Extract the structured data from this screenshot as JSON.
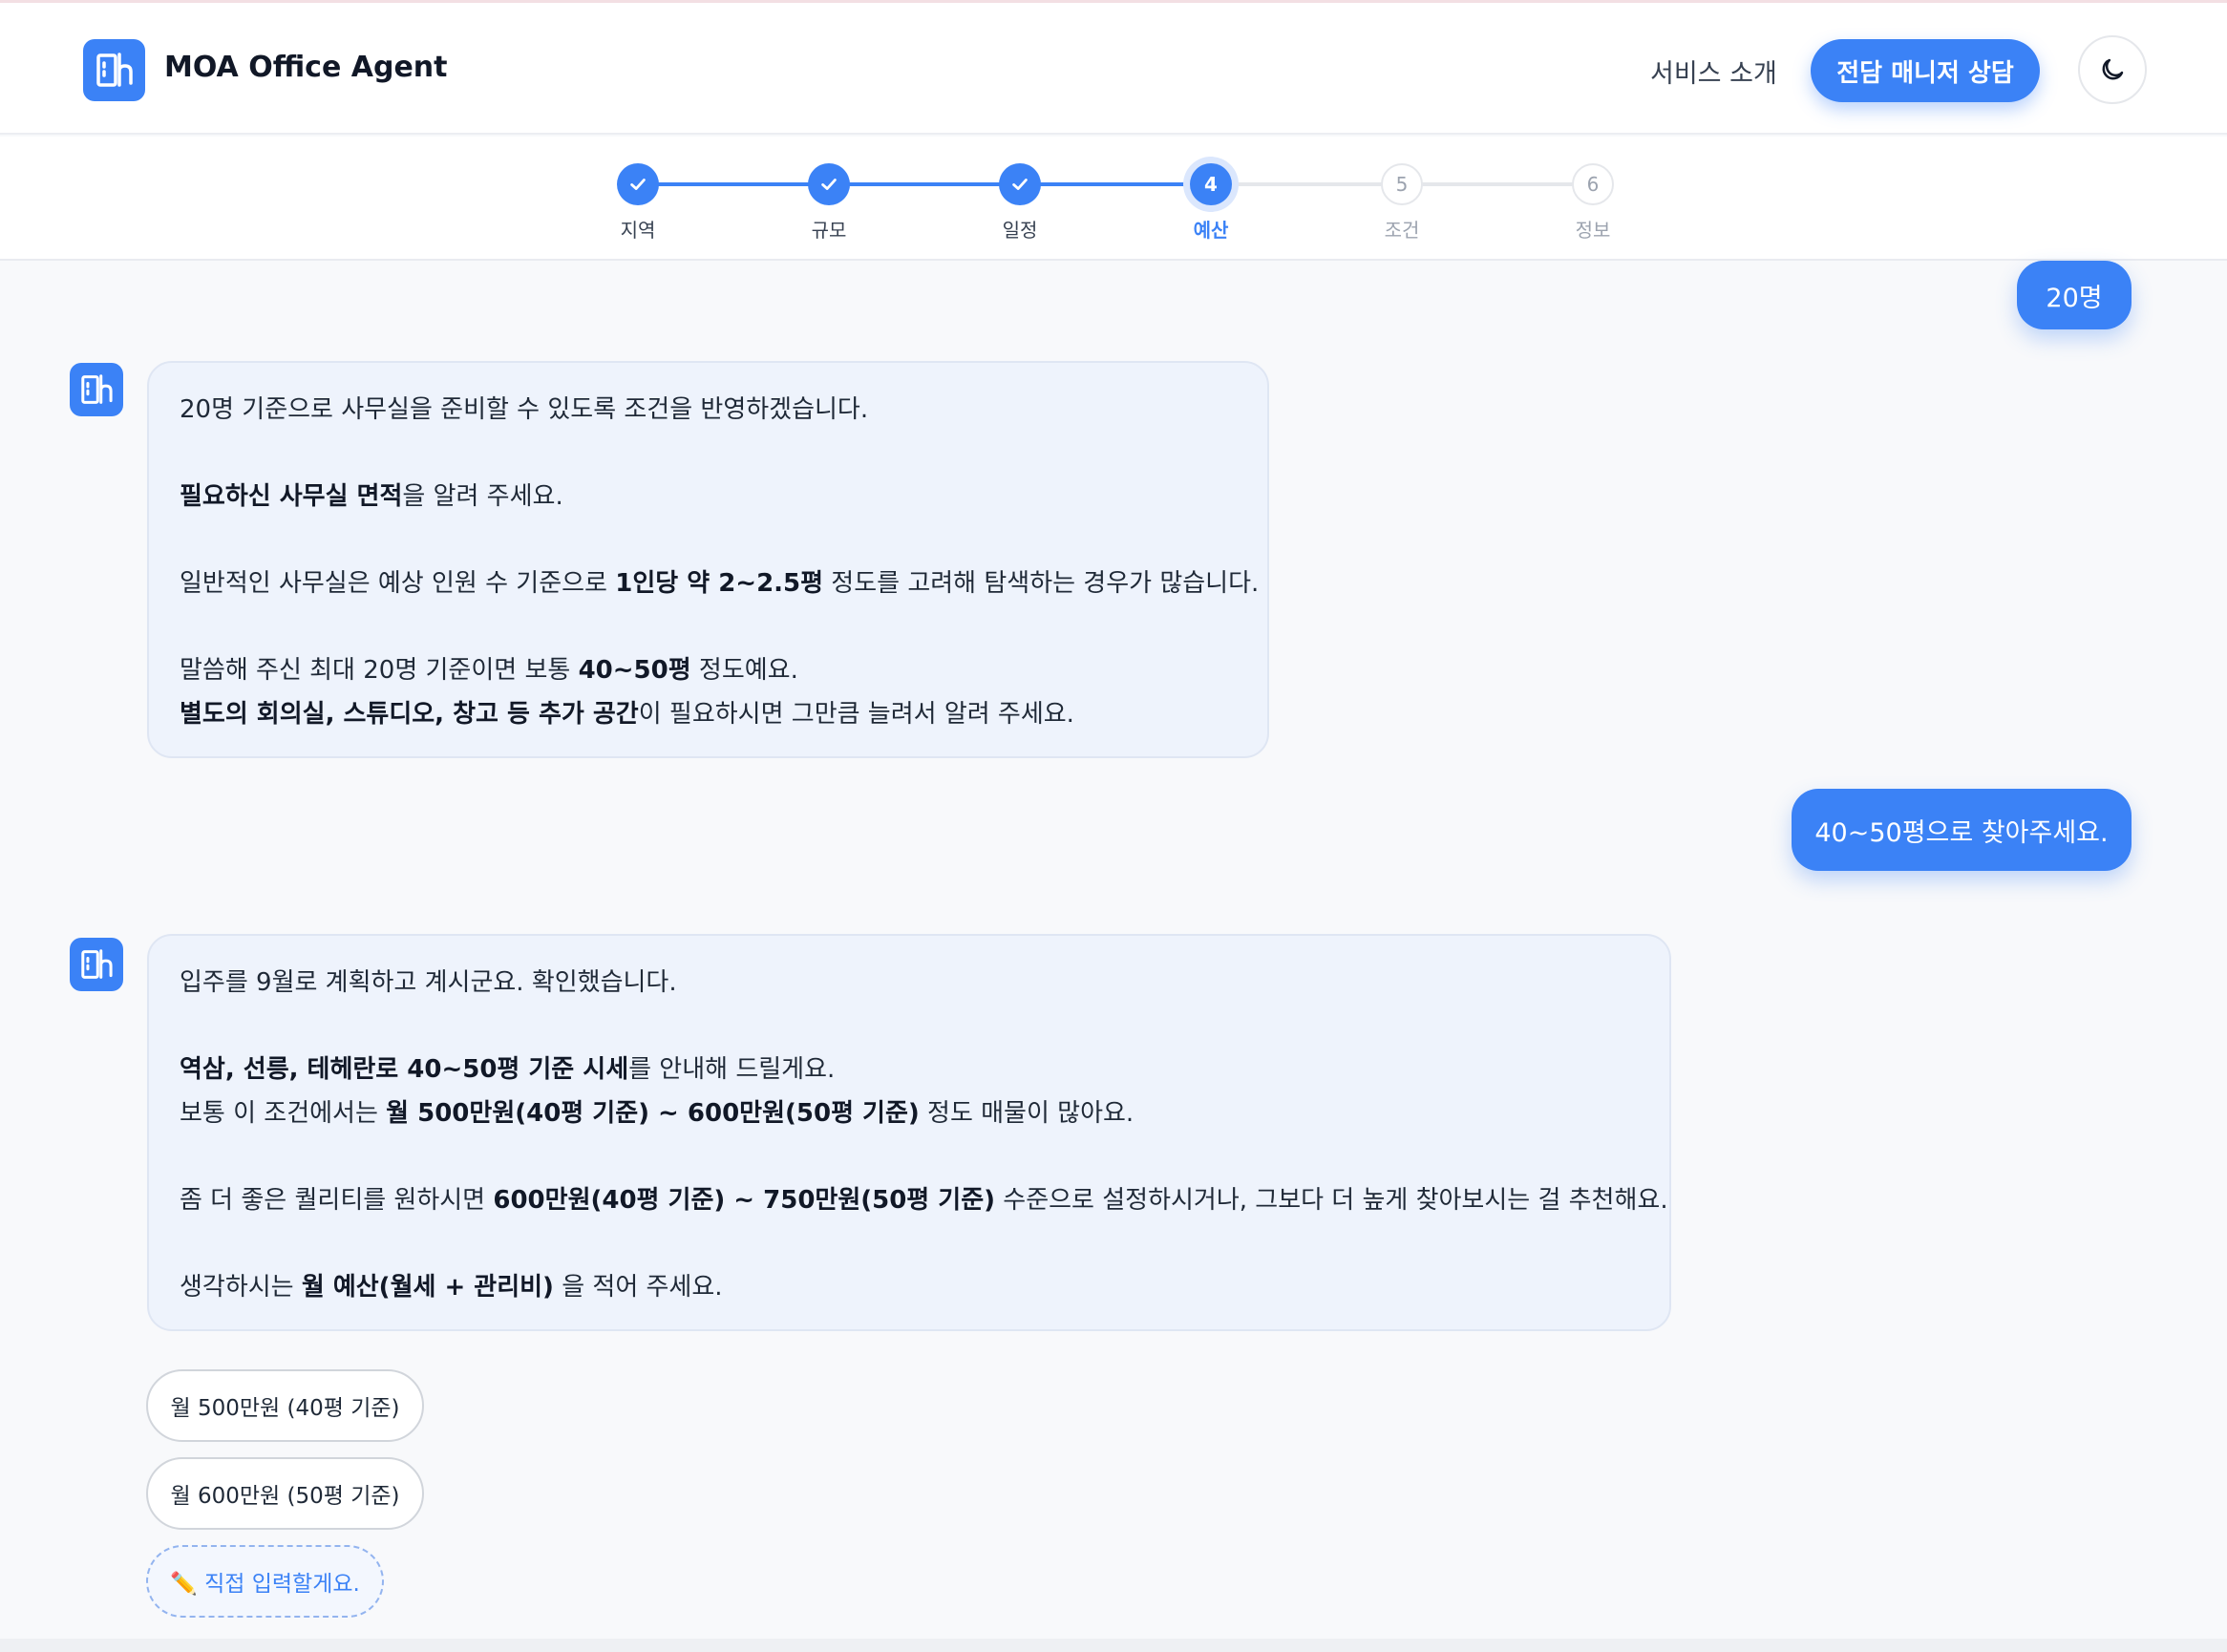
{
  "header": {
    "brand": "MOA Office Agent",
    "nav_link": "서비스 소개",
    "cta_label": "전담 매니저 상담",
    "theme_icon": "moon-icon",
    "logo_icon": "building-icon",
    "accent_color": "#3b82f6"
  },
  "steps": [
    {
      "label": "지역",
      "number": "1",
      "status": "done"
    },
    {
      "label": "규모",
      "number": "2",
      "status": "done"
    },
    {
      "label": "일정",
      "number": "3",
      "status": "done"
    },
    {
      "label": "예산",
      "number": "4",
      "status": "active"
    },
    {
      "label": "조건",
      "number": "5",
      "status": "todo"
    },
    {
      "label": "정보",
      "number": "6",
      "status": "todo"
    }
  ],
  "messages": {
    "user_1": "20명",
    "bot_1": {
      "line1": "20명 기준으로 사무실을 준비할 수 있도록 조건을 반영하겠습니다.",
      "l2_bold": "필요하신 사무실 면적",
      "l2_rest": "을 알려 주세요.",
      "l3_a": "일반적인 사무실은 예상 인원 수 기준으로 ",
      "l3_bold": "1인당 약 2~2.5평",
      "l3_b": " 정도를 고려해 탐색하는 경우가 많습니다.",
      "l4_a": "말씀해 주신 최대 20명 기준이면 보통 ",
      "l4_bold": "40~50평",
      "l4_b": " 정도예요.",
      "l5_bold": "별도의 회의실, 스튜디오, 창고 등 추가 공간",
      "l5_rest": "이 필요하시면 그만큼 늘려서 알려 주세요."
    },
    "user_2": "40~50평으로 찾아주세요.",
    "bot_2": {
      "line1": "입주를 9월로 계획하고 계시군요. 확인했습니다.",
      "l2_bold": "역삼, 선릉, 테헤란로 40~50평 기준 시세",
      "l2_rest": "를 안내해 드릴게요.",
      "l3_a": "보통 이 조건에서는 ",
      "l3_bold": "월 500만원(40평 기준) ~ 600만원(50평 기준)",
      "l3_b": " 정도 매물이 많아요.",
      "l4_a": "좀 더 좋은 퀄리티를 원하시면 ",
      "l4_bold": "600만원(40평 기준) ~ 750만원(50평 기준)",
      "l4_b": " 수준으로 설정하시거나, 그보다 더 높게 찾아보시는 걸 추천해요.",
      "l5_a": "생각하시는 ",
      "l5_bold": "월 예산(월세 + 관리비)",
      "l5_b": " 을 적어 주세요."
    }
  },
  "quick_replies": {
    "option_1": "월 500만원 (40평 기준)",
    "option_2": "월 600만원 (50평 기준)",
    "direct_input": "✏️ 직접 입력할게요."
  }
}
